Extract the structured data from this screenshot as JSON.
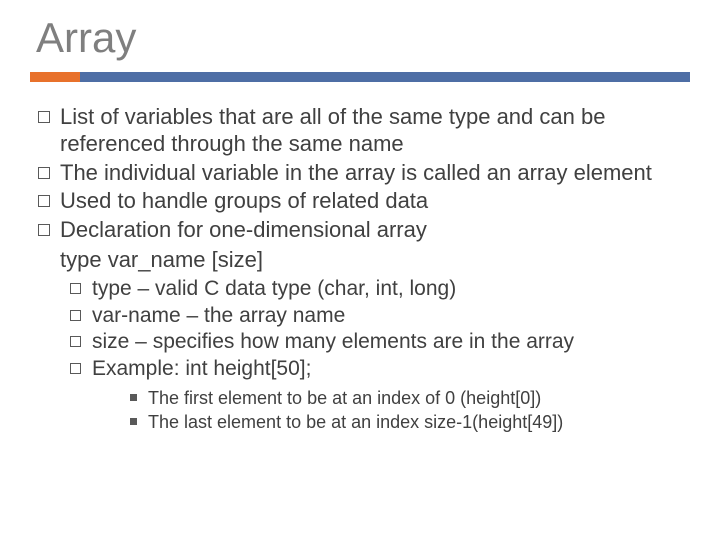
{
  "title": "Array",
  "bullets": {
    "b1": "List of variables that are all of the same type and can be referenced through the same name",
    "b2": "The individual variable in the array is called an array element",
    "b3": "Used to handle groups of related data",
    "b4": "Declaration for one-dimensional array"
  },
  "syntax": "type var_name [size]",
  "sub": {
    "s1": "type – valid C data type (char, int, long)",
    "s2": "var-name – the array name",
    "s3": "size – specifies how many elements are in the array",
    "s4": "Example: int height[50];"
  },
  "subsub": {
    "t1": "The first element to be at an index of 0 (height[0])",
    "t2": "The last element to be at an index size-1(height[49])"
  }
}
